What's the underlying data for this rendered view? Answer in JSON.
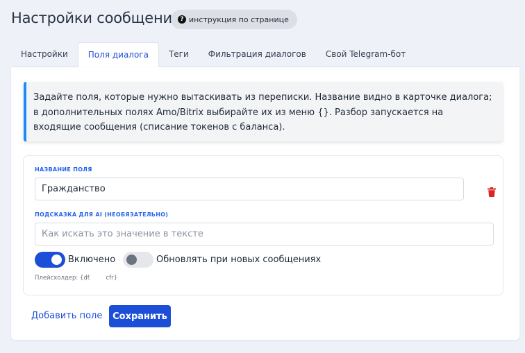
{
  "header": {
    "title": "Настройки сообщений",
    "help_chip": {
      "icon": "question-circle-icon",
      "label": "инструкция по странице"
    }
  },
  "tabs": [
    {
      "label": "Настройки",
      "active": false
    },
    {
      "label": "Поля диалога",
      "active": true
    },
    {
      "label": "Теги",
      "active": false
    },
    {
      "label": "Фильтрация диалогов",
      "active": false
    },
    {
      "label": "Свой Telegram-бот",
      "active": false
    }
  ],
  "info": {
    "text": "Задайте поля, которые нужно вытаскивать из переписки. Название видно в карточке диалога; в дополнительных полях Amo/Bitrix выбирайте их из меню {}. Разбор запускается на входящие сообщения (списание токенов с баланса).",
    "accent_color": "#1d8cf8"
  },
  "field": {
    "name_label": "Название поля",
    "name_value": "Гражданство",
    "hint_label": "Подсказка для AI (необязательно)",
    "hint_value": "",
    "hint_placeholder": "Как искать это значение в тексте",
    "delete_icon": "trash-icon",
    "delete_color": "#dc2626",
    "toggles": [
      {
        "label": "Включено",
        "on": true
      },
      {
        "label": "Обновлять при новых сообщениях",
        "on": false
      }
    ],
    "placeholder_note": "Плейсхолдер: {df.        cfr}"
  },
  "actions": {
    "add_label": "Добавить поле",
    "save_label": "Сохранить"
  },
  "colors": {
    "primary": "#1d4ed8",
    "background": "#eef1f8"
  }
}
